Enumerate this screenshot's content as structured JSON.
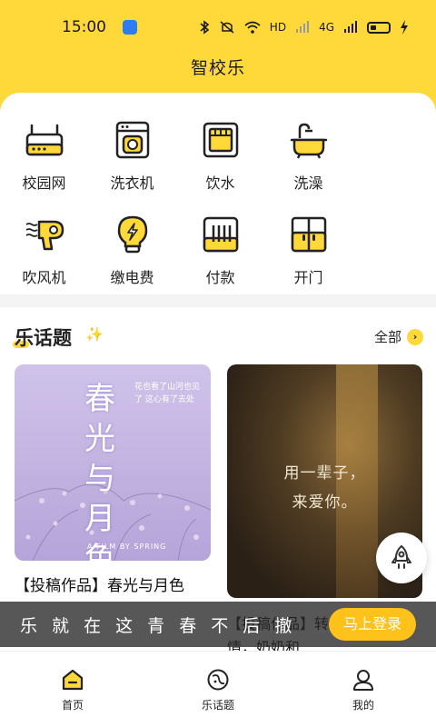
{
  "status_bar": {
    "time": "15:00",
    "network_label": "HD",
    "signal_label": "4G"
  },
  "header": {
    "title": "智校乐"
  },
  "services": [
    {
      "label": "校园网",
      "icon": "router-icon"
    },
    {
      "label": "洗衣机",
      "icon": "washing-machine-icon"
    },
    {
      "label": "饮水",
      "icon": "water-dispenser-icon"
    },
    {
      "label": "洗澡",
      "icon": "bathtub-icon"
    },
    {
      "label": "吹风机",
      "icon": "hair-dryer-icon"
    },
    {
      "label": "缴电费",
      "icon": "lightbulb-icon"
    },
    {
      "label": "付款",
      "icon": "payment-icon"
    },
    {
      "label": "开门",
      "icon": "door-icon"
    }
  ],
  "feed": {
    "title": "乐话题",
    "all_label": "全部",
    "cards": [
      {
        "image_title": "春光与月色",
        "image_note": "花也看了山河也见了 这心有了去处",
        "image_footer": "A FILM BY SPRING",
        "caption": "【投稿作品】春光与月色"
      },
      {
        "image_text_line1": "用一辈子，",
        "image_text_line2": "来爱你。",
        "caption": "【投稿作品】转，世世永长情，奶奶和"
      }
    ]
  },
  "banner": {
    "slogan": "乐 就 在 这   青 春 不 后 撤",
    "login_label": "马上登录"
  },
  "tabbar": [
    {
      "label": "首页",
      "icon": "home-icon"
    },
    {
      "label": "乐话题",
      "icon": "topic-icon"
    },
    {
      "label": "我的",
      "icon": "profile-icon"
    }
  ],
  "colors": {
    "brand": "#ffd83a",
    "button": "#ffc21a"
  }
}
